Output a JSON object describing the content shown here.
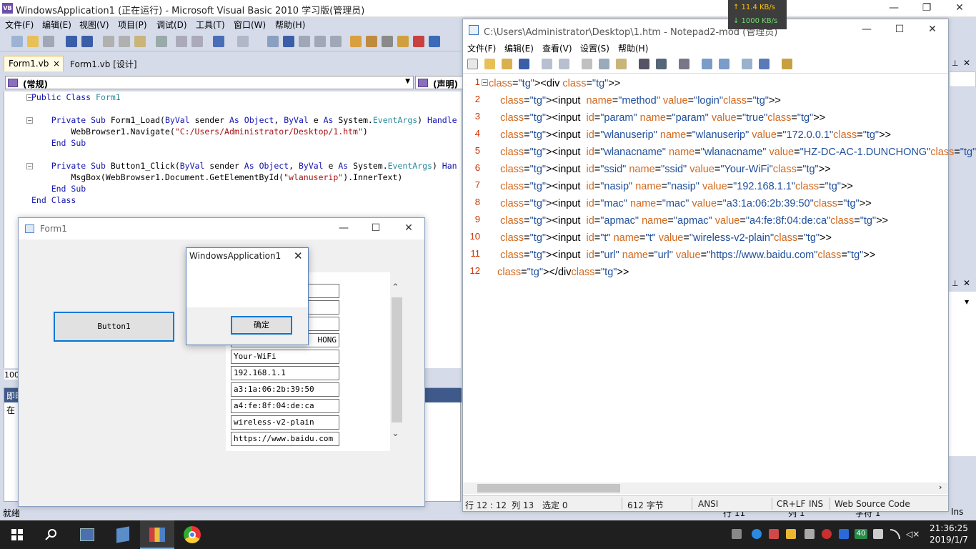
{
  "vs": {
    "title": "WindowsApplication1 (正在运行) - Microsoft Visual Basic 2010 学习版(管理员)",
    "logo": "VB",
    "menu": [
      "文件(F)",
      "编辑(E)",
      "视图(V)",
      "项目(P)",
      "调试(D)",
      "工具(T)",
      "窗口(W)",
      "帮助(H)"
    ],
    "tabs": [
      "Form1.vb",
      "Form1.vb [设计]"
    ],
    "tab_close": "×",
    "combo_left": "(常规)",
    "combo_right": "(声明)",
    "code": [
      "Public Class Form1",
      "",
      "    Private Sub Form1_Load(ByVal sender As Object, ByVal e As System.EventArgs) Handle",
      "        WebBrowser1.Navigate(\"C:/Users/Administrator/Desktop/1.htm\")",
      "    End Sub",
      "",
      "    Private Sub Button1_Click(ByVal sender As Object, ByVal e As System.EventArgs) Han",
      "        MsgBox(WebBrowser1.Document.GetElementById(\"wlanuserip\").InnerText)",
      "    End Sub",
      "End Class"
    ],
    "zoom": "100",
    "immediate_title": "即时",
    "immediate_text": "在",
    "status": "就绪",
    "status_row": "行 11",
    "status_col": "列 1",
    "status_char": "字符 1",
    "status_ins": "Ins"
  },
  "form1": {
    "title": "Form1",
    "button": "Button1",
    "fields": [
      "",
      "",
      "",
      "HONG",
      "Your-WiFi",
      "192.168.1.1",
      "a3:1a:06:2b:39:50",
      "a4:fe:8f:04:de:ca",
      "wireless-v2-plain",
      "https://www.baidu.com"
    ]
  },
  "msgbox": {
    "title": "WindowsApplication1",
    "close": "✕",
    "ok": "确定"
  },
  "notepad": {
    "title": "C:\\Users\\Administrator\\Desktop\\1.htm - Notepad2-mod (管理员)",
    "menu": [
      "文件(F)",
      "编辑(E)",
      "查看(V)",
      "设置(S)",
      "帮助(H)"
    ],
    "lines": [
      "<div >",
      "    <input  name=\"method\" value=\"login\">",
      "    <input  id=\"param\" name=\"param\" value=\"true\">",
      "    <input  id=\"wlanuserip\" name=\"wlanuserip\" value=\"172.0.0.1\">",
      "    <input  id=\"wlanacname\" name=\"wlanacname\" value=\"HZ-DC-AC-1.DUNCHONG\">",
      "    <input  id=\"ssid\" name=\"ssid\" value=\"Your-WiFi\">",
      "    <input  id=\"nasip\" name=\"nasip\" value=\"192.168.1.1\">",
      "    <input  id=\"mac\" name=\"mac\" value=\"a3:1a:06:2b:39:50\">",
      "    <input  id=\"apmac\" name=\"apmac\" value=\"a4:fe:8f:04:de:ca\">",
      "    <input  id=\"t\" name=\"t\" value=\"wireless-v2-plain\">",
      "    <input  id=\"url\" name=\"url\" value=\"https://www.baidu.com\">",
      "   </div>"
    ],
    "line_numbers": [
      "1",
      "2",
      "3",
      "4",
      "5",
      "6",
      "7",
      "8",
      "9",
      "10",
      "11",
      "12"
    ],
    "status": {
      "position": "行 12 : 12",
      "column": "列 13",
      "selection": "选定 0",
      "bytes": "612 字节",
      "encoding": "ANSI",
      "eol": "CR+LF",
      "ins": "INS",
      "scheme": "Web Source Code"
    }
  },
  "netmeter": {
    "up": "↑ 11.4 KB/s",
    "down": "↓ 1000 KB/s"
  },
  "taskbar": {
    "time": "21:36:25",
    "date": "2019/1/7",
    "battery_badge": "40"
  },
  "colors": {
    "accent": "#0078d7",
    "vs_bg": "#d6dbe9",
    "taskbar": "#1f1f1f"
  }
}
